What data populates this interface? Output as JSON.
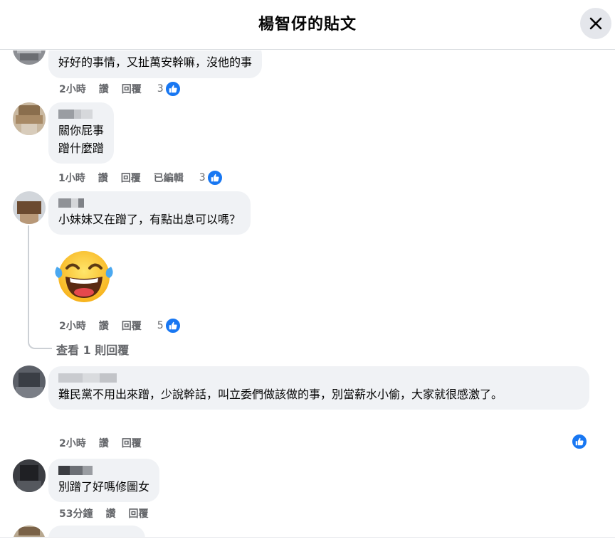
{
  "header": {
    "title": "楊智伢的貼文"
  },
  "comments": [
    {
      "text": "好好的事情，又扯萬安幹嘛，沒他的事",
      "time": "2小時",
      "like_label": "讚",
      "reply_label": "回覆",
      "reaction_count": "3"
    },
    {
      "text": "關你屁事\n蹭什麼蹭",
      "time": "1小時",
      "like_label": "讚",
      "reply_label": "回覆",
      "edited_label": "已編輯",
      "reaction_count": "3"
    },
    {
      "text": "小妹妹又在蹭了，有點出息可以嗎？",
      "sticker": "tears-of-joy-emoji",
      "time": "2小時",
      "like_label": "讚",
      "reply_label": "回覆",
      "reaction_count": "5",
      "view_replies": "查看 1 則回覆"
    },
    {
      "text": "難民黨不用出來蹭，少說幹話，叫立委們做該做的事，別當薪水小偷，大家就很感激了。",
      "time": "2小時",
      "like_label": "讚",
      "reply_label": "回覆"
    },
    {
      "text": "別蹭了好嗎修圖女",
      "time": "53分鐘",
      "like_label": "讚",
      "reply_label": "回覆"
    }
  ],
  "colors": {
    "like_blue": "#1877f2",
    "bubble_bg": "#f0f2f5",
    "meta_gray": "#65676b"
  },
  "icons": {
    "close": "close-icon",
    "like": "thumbs-up-icon"
  }
}
